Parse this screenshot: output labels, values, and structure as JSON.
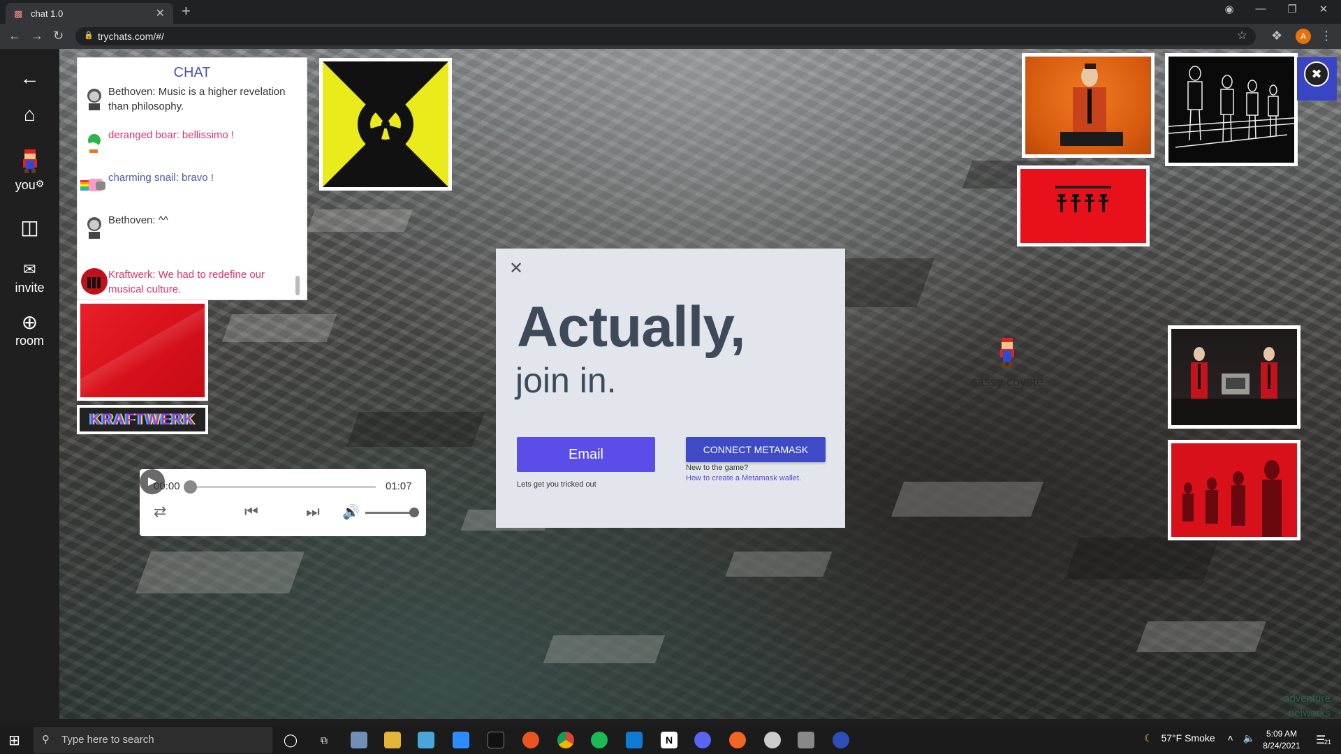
{
  "browser": {
    "tab_title": "chat 1.0",
    "url": "trychats.com/#/",
    "profile_initial": "A"
  },
  "rail": {
    "you_label": "you",
    "invite_label": "invite",
    "room_label": "room"
  },
  "chat": {
    "title": "CHAT",
    "messages": [
      {
        "text": "Bethoven: Music is a higher revelation than philosophy.",
        "color": "#333333"
      },
      {
        "text": "deranged boar: bellissimo !",
        "color": "#e0306a"
      },
      {
        "text": "charming snail: bravo !",
        "color": "#4a55b5"
      },
      {
        "text": "Bethoven: ^^",
        "color": "#333333"
      },
      {
        "text": "Kraftwerk: We had to redefine our musical culture.",
        "color": "#e0306a"
      }
    ]
  },
  "tiles": {
    "kraftwerk_banner": "KRAFTWERK"
  },
  "player": {
    "current_time": "00:00",
    "duration": "01:07",
    "progress": 0,
    "volume": 1
  },
  "modal": {
    "headline": "Actually,",
    "subheadline": "join in.",
    "email_button": "Email",
    "email_note": "Lets get you tricked out",
    "metamask_button": "CONNECT METAMASK",
    "metamask_question": "New to the game?",
    "metamask_link": "How to create a Metamask wallet."
  },
  "world": {
    "sprite_name": "sassy coyote",
    "corner_line1": "adventure",
    "corner_line2": "networks"
  },
  "taskbar": {
    "search_placeholder": "Type here to search",
    "weather": "57°F  Smoke",
    "time": "5:09 AM",
    "date": "8/24/2021",
    "notification_count": "21"
  },
  "colors": {
    "accent_email": "#5a4de8",
    "accent_metamask": "#3f4bc6",
    "chat_title": "#4a55b5",
    "modal_bg": "#e2e6ec"
  }
}
